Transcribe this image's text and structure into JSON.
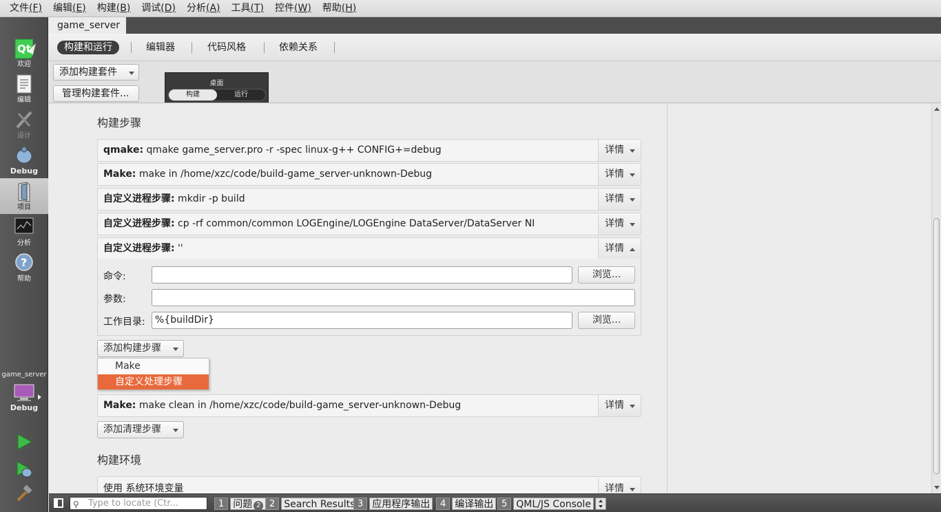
{
  "menu": [
    {
      "label": "文件",
      "key": "(F)"
    },
    {
      "label": "编辑",
      "key": "(E)"
    },
    {
      "label": "构建",
      "key": "(B)"
    },
    {
      "label": "调试",
      "key": "(D)"
    },
    {
      "label": "分析",
      "key": "(A)"
    },
    {
      "label": "工具",
      "key": "(T)"
    },
    {
      "label": "控件",
      "key": "(W)"
    },
    {
      "label": "帮助",
      "key": "(H)"
    }
  ],
  "modes": {
    "welcome": "欢迎",
    "edit": "编辑",
    "design": "设计",
    "debug": "Debug",
    "projects": "项目",
    "analyze": "分析",
    "help": "帮助"
  },
  "target": {
    "project": "game_server",
    "config": "Debug"
  },
  "project_tab": "game_server",
  "subtabs": [
    "构建和运行",
    "编辑器",
    "代码风格",
    "依赖关系"
  ],
  "kit": {
    "add_kit": "添加构建套件",
    "manage_kits": "管理构建套件...",
    "name": "桌面",
    "build": "构建",
    "run": "运行"
  },
  "build_steps_title": "构建步骤",
  "steps": [
    {
      "prefix": "qmake:",
      "text": " qmake game_server.pro -r -spec linux-g++ CONFIG+=debug",
      "details": "详情"
    },
    {
      "prefix": "Make:",
      "text": " make in /home/xzc/code/build-game_server-unknown-Debug",
      "details": "详情"
    },
    {
      "prefix": "自定义进程步骤:",
      "text": " mkdir -p build",
      "details": "详情"
    },
    {
      "prefix": "自定义进程步骤:",
      "text": " cp -rf common/common LOGEngine/LOGEngine DataServer/DataServer NI",
      "details": "详情"
    },
    {
      "prefix": "自定义进程步骤:",
      "text": " ''",
      "details": "详情"
    }
  ],
  "custom_form": {
    "command_label": "命令:",
    "command_value": "",
    "args_label": "参数:",
    "args_value": "",
    "workdir_label": "工作目录:",
    "workdir_value": "%{buildDir}",
    "browse": "浏览..."
  },
  "add_build_step": "添加构建步骤",
  "dropdown": [
    "Make",
    "自定义处理步骤"
  ],
  "clean_step": {
    "prefix": "Make:",
    "text": " make clean in /home/xzc/code/build-game_server-unknown-Debug",
    "details": "详情"
  },
  "add_clean_step": "添加清理步骤",
  "build_env_title": "构建环境",
  "env_step": {
    "text": "使用 系统环境变量",
    "details": "详情"
  },
  "statusbar": {
    "locator_placeholder": "Type to locate (Ctr...",
    "tabs": [
      {
        "num": "1",
        "label": "问题",
        "badge": "2"
      },
      {
        "num": "2",
        "label": "Search Results"
      },
      {
        "num": "3",
        "label": "应用程序输出"
      },
      {
        "num": "4",
        "label": "编译输出"
      },
      {
        "num": "5",
        "label": "QML/JS Console"
      }
    ]
  },
  "colors": {
    "accent": "#e8693b",
    "sidebar": "#4f4f4f"
  }
}
